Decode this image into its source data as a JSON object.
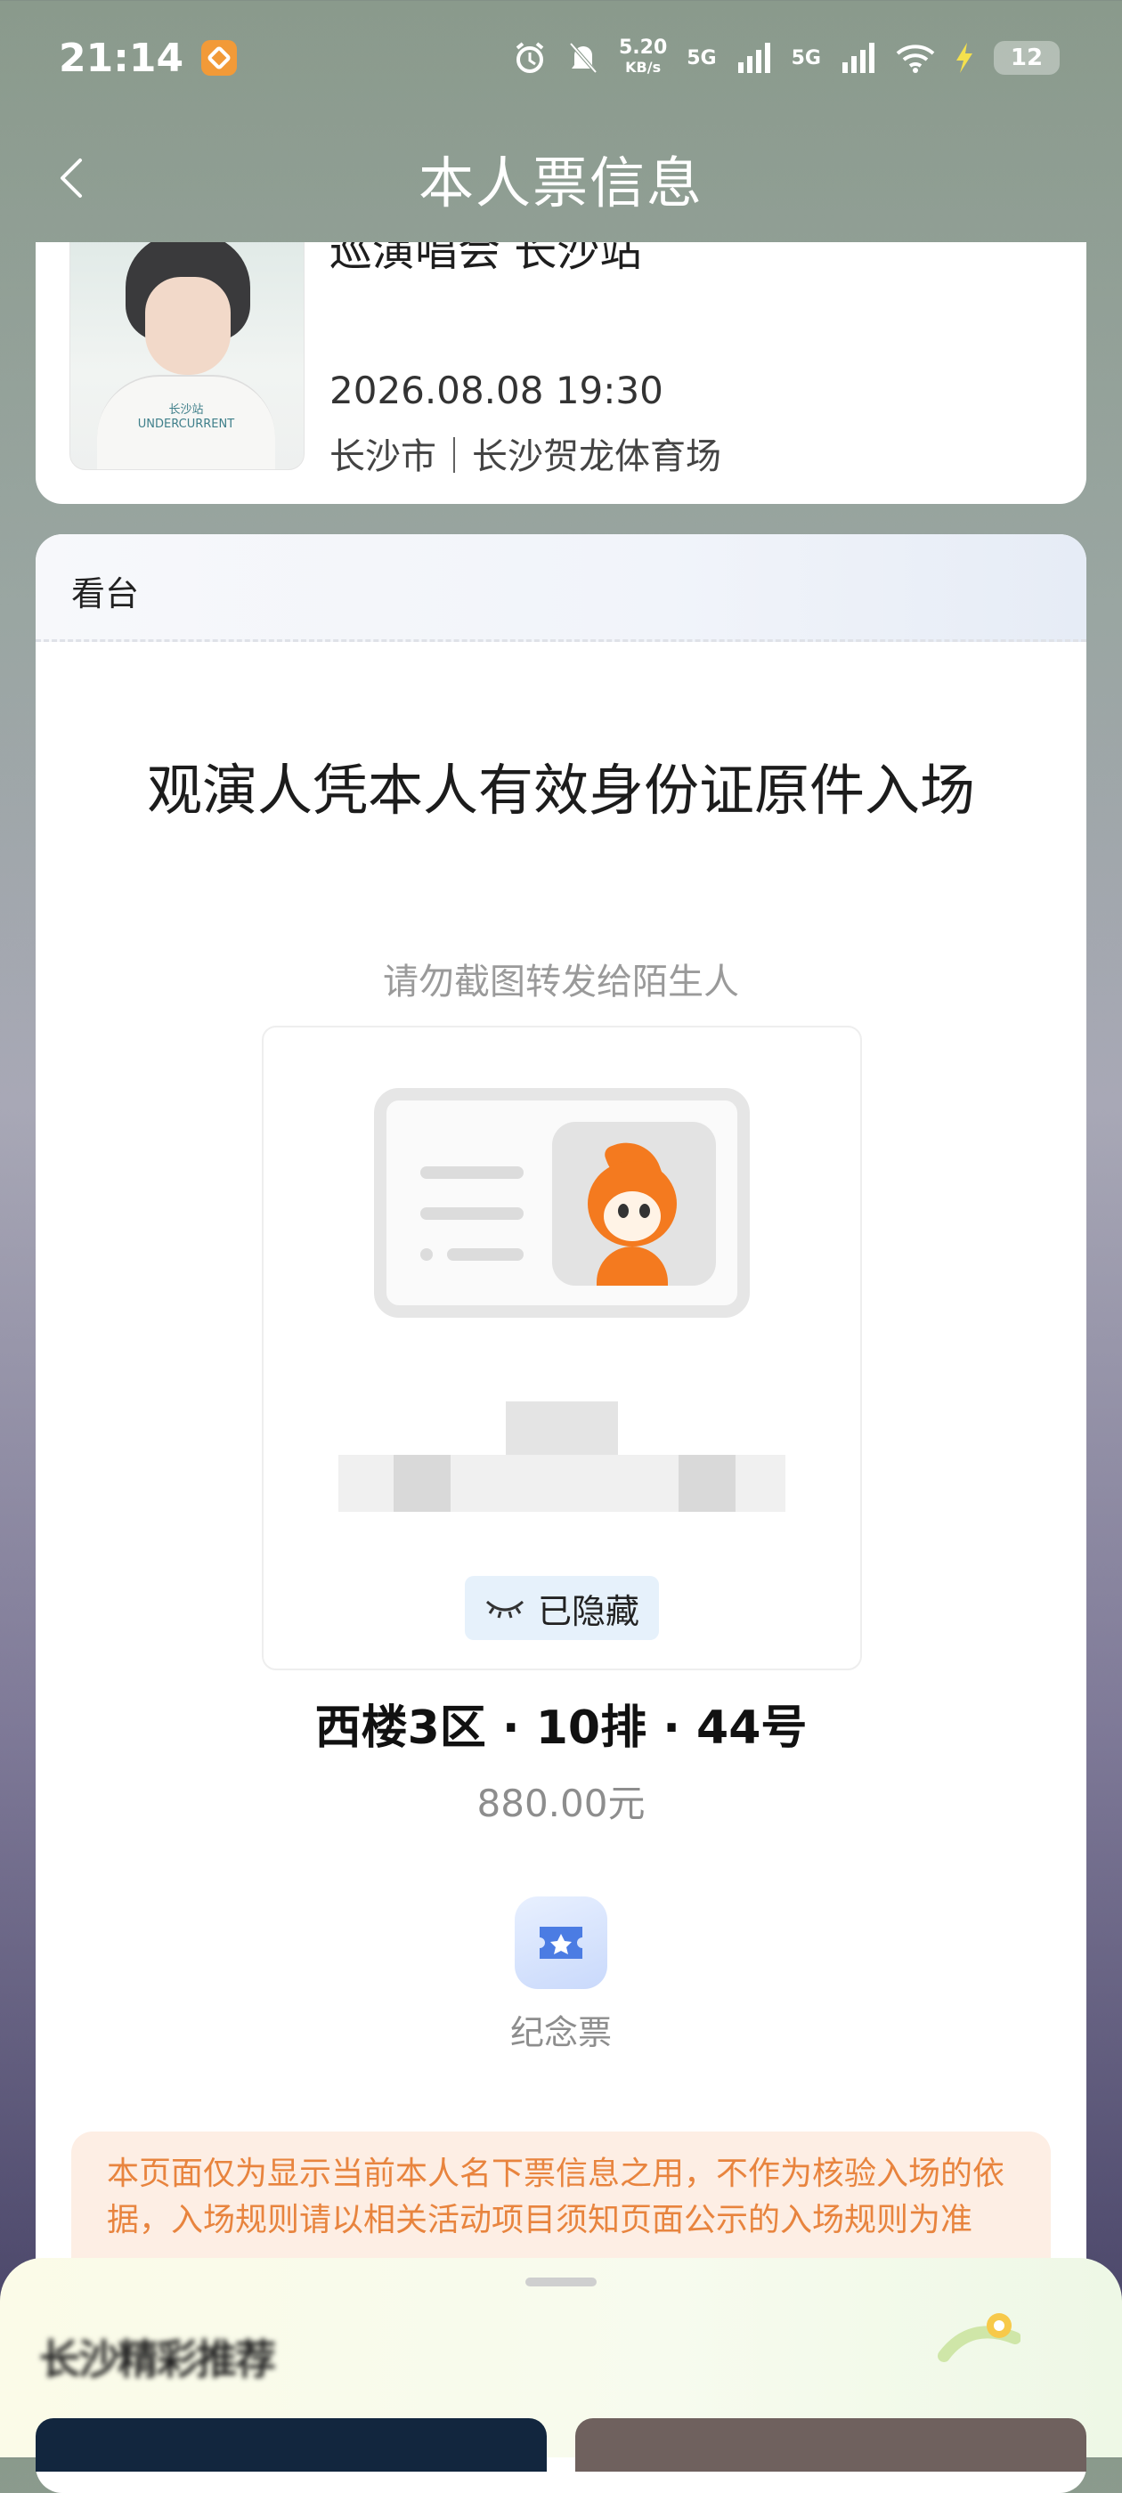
{
  "status_bar": {
    "time": "21:14",
    "net_speed_value": "5.20",
    "net_speed_unit": "KB/s",
    "sim1": "5G",
    "sim2": "5G",
    "battery": "12"
  },
  "header": {
    "title": "本人票信息"
  },
  "event": {
    "title_fragment": "巡演唱会 长沙站",
    "datetime": "2026.08.08 19:30",
    "venue": "长沙市｜长沙贺龙体育场",
    "poster_city": "长沙站",
    "poster_brand": "UNDERCURRENT"
  },
  "ticket": {
    "zone": "看台",
    "entry_notice": "观演人凭本人有效身份证原件入场",
    "screenshot_warning": "请勿截图转发给陌生人",
    "hidden_label": "已隐藏",
    "seat": "西楼3区 · 10排 · 44号",
    "price": "880.00元",
    "souvenir_label": "纪念票",
    "disclaimer": "本页面仅为显示当前本人名下票信息之用，不作为核验入场的依据，入场规则请以相关活动项目须知页面公示的入场规则为准"
  },
  "bottom_sheet": {
    "title": "长沙精彩推荐"
  },
  "colors": {
    "accent_orange": "#e8843e",
    "pill_blue": "#e6f1fb",
    "mascot_orange": "#f47a1f"
  }
}
